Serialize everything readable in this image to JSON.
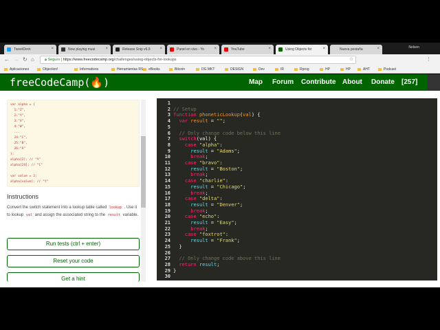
{
  "browser": {
    "tabs": [
      {
        "label": "TweetDeck",
        "color": "#1da1f2"
      },
      {
        "label": "Now playing musi",
        "color": "#333"
      },
      {
        "label": "Release Snip v6.9",
        "color": "#222"
      },
      {
        "label": "Panel en vivo - Yo",
        "color": "#e00"
      },
      {
        "label": "YouTube",
        "color": "#e00"
      },
      {
        "label": "Using Objects for",
        "color": "#006400",
        "active": true
      },
      {
        "label": "Nueva pestaña",
        "color": ""
      }
    ],
    "profile": "Nelson",
    "secure_label": "Seguro",
    "url_scheme": "https://",
    "url_host": "www.freecodecamp.org",
    "url_path": "/challenges/using-objects-for-lookups",
    "bookmarks": [
      "Aplicaciones",
      "Objection!",
      "Informativos",
      "Herramientas RS",
      "eBooks",
      "Bitcoin",
      "DG MKT",
      "DESIGN",
      "Dev",
      "IR",
      "Rprog",
      "HP",
      "HP",
      "AHT",
      "Podcast"
    ]
  },
  "nav": {
    "logo": "freeCodeCamp(🔥)",
    "links": [
      "Map",
      "Forum",
      "Contribute",
      "About",
      "Donate",
      "[257]"
    ]
  },
  "example_code": "var alpha = {\n  1:\"Z\",\n  2:\"Y\",\n  3:\"X\",\n  4:\"W\",\n  ...\n  24:\"C\",\n  25:\"B\",\n  26:\"A\"\n};\nalpha[2]; // \"Y\"\nalpha[24]; // \"C\"\n\nvar value = 2;\nalpha[value]; // \"Y\"",
  "instructions": {
    "title": "Instructions",
    "p1": "Convert the switch statement into a lookup table called",
    "code1": "lookup",
    "p2": ". Use it to lookup",
    "code2": "val",
    "p3": "and assign the associated string to the",
    "code3": "result",
    "p4": "variable."
  },
  "buttons": {
    "run": "Run tests (ctrl + enter)",
    "reset": "Reset your code",
    "hint": "Get a hint"
  },
  "editor": {
    "lines": [
      [],
      [
        [
          "com",
          "// Setup"
        ]
      ],
      [
        [
          "kw",
          "function "
        ],
        [
          "fn",
          "phoneticLookup"
        ],
        [
          "p",
          "("
        ],
        [
          "fn",
          "val"
        ],
        [
          "p",
          ") {"
        ]
      ],
      [
        [
          "p",
          "  "
        ],
        [
          "kw",
          "var "
        ],
        [
          "fn",
          "result"
        ],
        [
          "p",
          " = "
        ],
        [
          "str",
          "\"\""
        ],
        [
          "p",
          ";"
        ]
      ],
      [],
      [
        [
          "com",
          "  // Only change code below this line"
        ]
      ],
      [
        [
          "p",
          "  "
        ],
        [
          "kw",
          "switch"
        ],
        [
          "p",
          "(val) {"
        ]
      ],
      [
        [
          "p",
          "    "
        ],
        [
          "kw",
          "case "
        ],
        [
          "str",
          "\"alpha\""
        ],
        [
          "p",
          ":"
        ]
      ],
      [
        [
          "p",
          "      "
        ],
        [
          "var",
          "result"
        ],
        [
          "p",
          " = "
        ],
        [
          "str",
          "\"Adams\""
        ],
        [
          "p",
          ";"
        ]
      ],
      [
        [
          "p",
          "      "
        ],
        [
          "kw",
          "break"
        ],
        [
          "p",
          ";"
        ]
      ],
      [
        [
          "p",
          "    "
        ],
        [
          "kw",
          "case "
        ],
        [
          "str",
          "\"bravo\""
        ],
        [
          "p",
          ":"
        ]
      ],
      [
        [
          "p",
          "      "
        ],
        [
          "var",
          "result"
        ],
        [
          "p",
          " = "
        ],
        [
          "str",
          "\"Boston\""
        ],
        [
          "p",
          ";"
        ]
      ],
      [
        [
          "p",
          "      "
        ],
        [
          "kw",
          "break"
        ],
        [
          "p",
          ";"
        ]
      ],
      [
        [
          "p",
          "    "
        ],
        [
          "kw",
          "case "
        ],
        [
          "str",
          "\"charlie\""
        ],
        [
          "p",
          ":"
        ]
      ],
      [
        [
          "p",
          "      "
        ],
        [
          "var",
          "result"
        ],
        [
          "p",
          " = "
        ],
        [
          "str",
          "\"Chicago\""
        ],
        [
          "p",
          ";"
        ]
      ],
      [
        [
          "p",
          "      "
        ],
        [
          "kw",
          "break"
        ],
        [
          "p",
          ";"
        ]
      ],
      [
        [
          "p",
          "    "
        ],
        [
          "kw",
          "case "
        ],
        [
          "str",
          "\"delta\""
        ],
        [
          "p",
          ":"
        ]
      ],
      [
        [
          "p",
          "      "
        ],
        [
          "var",
          "result"
        ],
        [
          "p",
          " = "
        ],
        [
          "str",
          "\"Denver\""
        ],
        [
          "p",
          ";"
        ]
      ],
      [
        [
          "p",
          "      "
        ],
        [
          "kw",
          "break"
        ],
        [
          "p",
          ";"
        ]
      ],
      [
        [
          "p",
          "    "
        ],
        [
          "kw",
          "case "
        ],
        [
          "str",
          "\"echo\""
        ],
        [
          "p",
          ":"
        ]
      ],
      [
        [
          "p",
          "      "
        ],
        [
          "var",
          "result"
        ],
        [
          "p",
          " = "
        ],
        [
          "str",
          "\"Easy\""
        ],
        [
          "p",
          ";"
        ]
      ],
      [
        [
          "p",
          "      "
        ],
        [
          "kw",
          "break"
        ],
        [
          "p",
          ";"
        ]
      ],
      [
        [
          "p",
          "    "
        ],
        [
          "kw",
          "case "
        ],
        [
          "str",
          "\"foxtrot\""
        ],
        [
          "p",
          ":"
        ]
      ],
      [
        [
          "p",
          "      "
        ],
        [
          "var",
          "result"
        ],
        [
          "p",
          " = "
        ],
        [
          "str",
          "\"Frank\""
        ],
        [
          "p",
          ";"
        ]
      ],
      [
        [
          "p",
          "  }"
        ]
      ],
      [],
      [
        [
          "com",
          "  // Only change code above this line"
        ]
      ],
      [
        [
          "p",
          "  "
        ],
        [
          "kw",
          "return "
        ],
        [
          "var",
          "result"
        ],
        [
          "p",
          ";"
        ]
      ],
      [
        [
          "p",
          "}"
        ]
      ],
      []
    ]
  }
}
